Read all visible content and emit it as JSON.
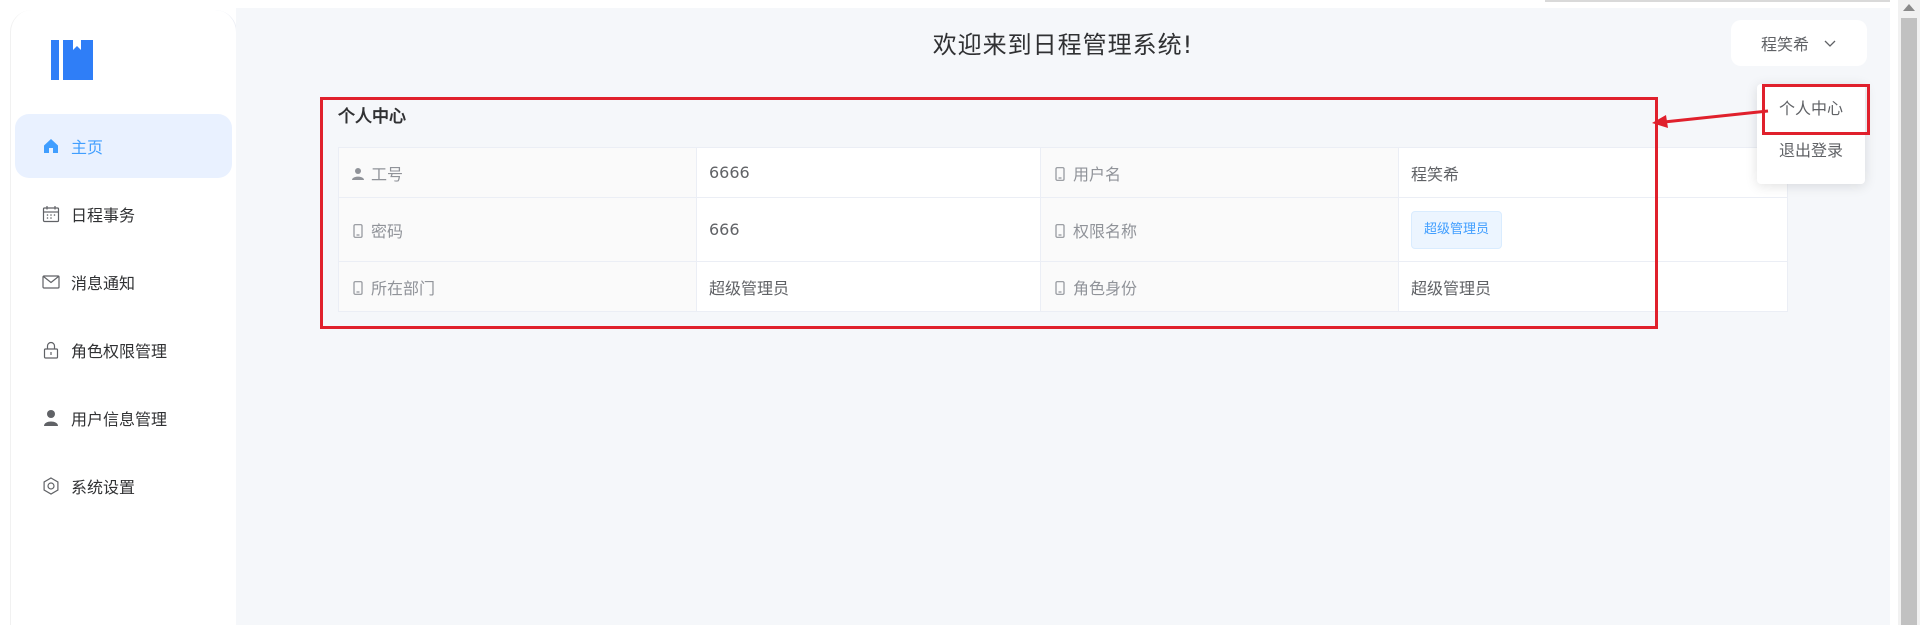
{
  "header": {
    "title": "欢迎来到日程管理系统!"
  },
  "user_menu": {
    "username": "程笑希",
    "chevron_icon": "chevron-down-icon"
  },
  "dropdown": {
    "items": [
      "个人中心",
      "退出登录"
    ]
  },
  "sidebar": {
    "items": [
      {
        "label": "主页",
        "icon": "home-icon",
        "active": true
      },
      {
        "label": "日程事务",
        "icon": "calendar-icon",
        "active": false
      },
      {
        "label": "消息通知",
        "icon": "mail-icon",
        "active": false
      },
      {
        "label": "角色权限管理",
        "icon": "lock-icon",
        "active": false
      },
      {
        "label": "用户信息管理",
        "icon": "user-icon",
        "active": false
      },
      {
        "label": "系统设置",
        "icon": "settings-icon",
        "active": false
      }
    ]
  },
  "profile": {
    "title": "个人中心",
    "rows": [
      {
        "label1": "工号",
        "value1": "6666",
        "label2": "用户名",
        "value2": "程笑希"
      },
      {
        "label1": "密码",
        "value1": "666",
        "label2": "权限名称",
        "value2": "超级管理员"
      },
      {
        "label1": "所在部门",
        "value1": "超级管理员",
        "label2": "角色身份",
        "value2": "超级管理员"
      }
    ]
  },
  "colors": {
    "accent": "#409eff",
    "annotation": "#e0202c",
    "background": "#f5f7fa"
  }
}
